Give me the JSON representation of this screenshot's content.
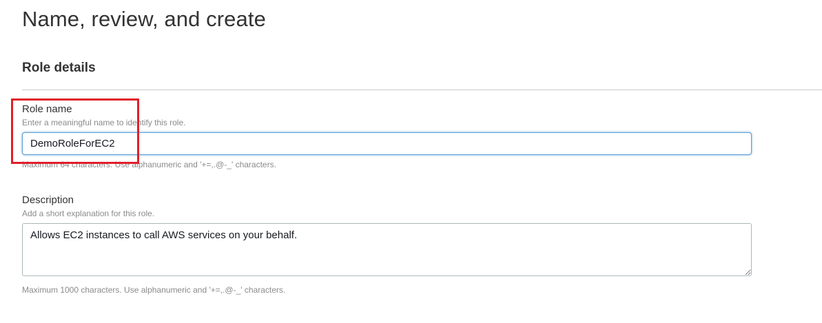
{
  "page": {
    "title": "Name, review, and create"
  },
  "role_details": {
    "section_title": "Role details",
    "role_name": {
      "label": "Role name",
      "description": "Enter a meaningful name to identify this role.",
      "value": "DemoRoleForEC2",
      "constraint": "Maximum 64 characters. Use alphanumeric and '+=,.@-_' characters."
    },
    "description": {
      "label": "Description",
      "description": "Add a short explanation for this role.",
      "value": "Allows EC2 instances to call AWS services on your behalf.",
      "constraint": "Maximum 1000 characters. Use alphanumeric and '+=,.@-_' characters."
    }
  },
  "colors": {
    "highlight": "#e01e2a",
    "focus_border": "#5b9bd5"
  }
}
